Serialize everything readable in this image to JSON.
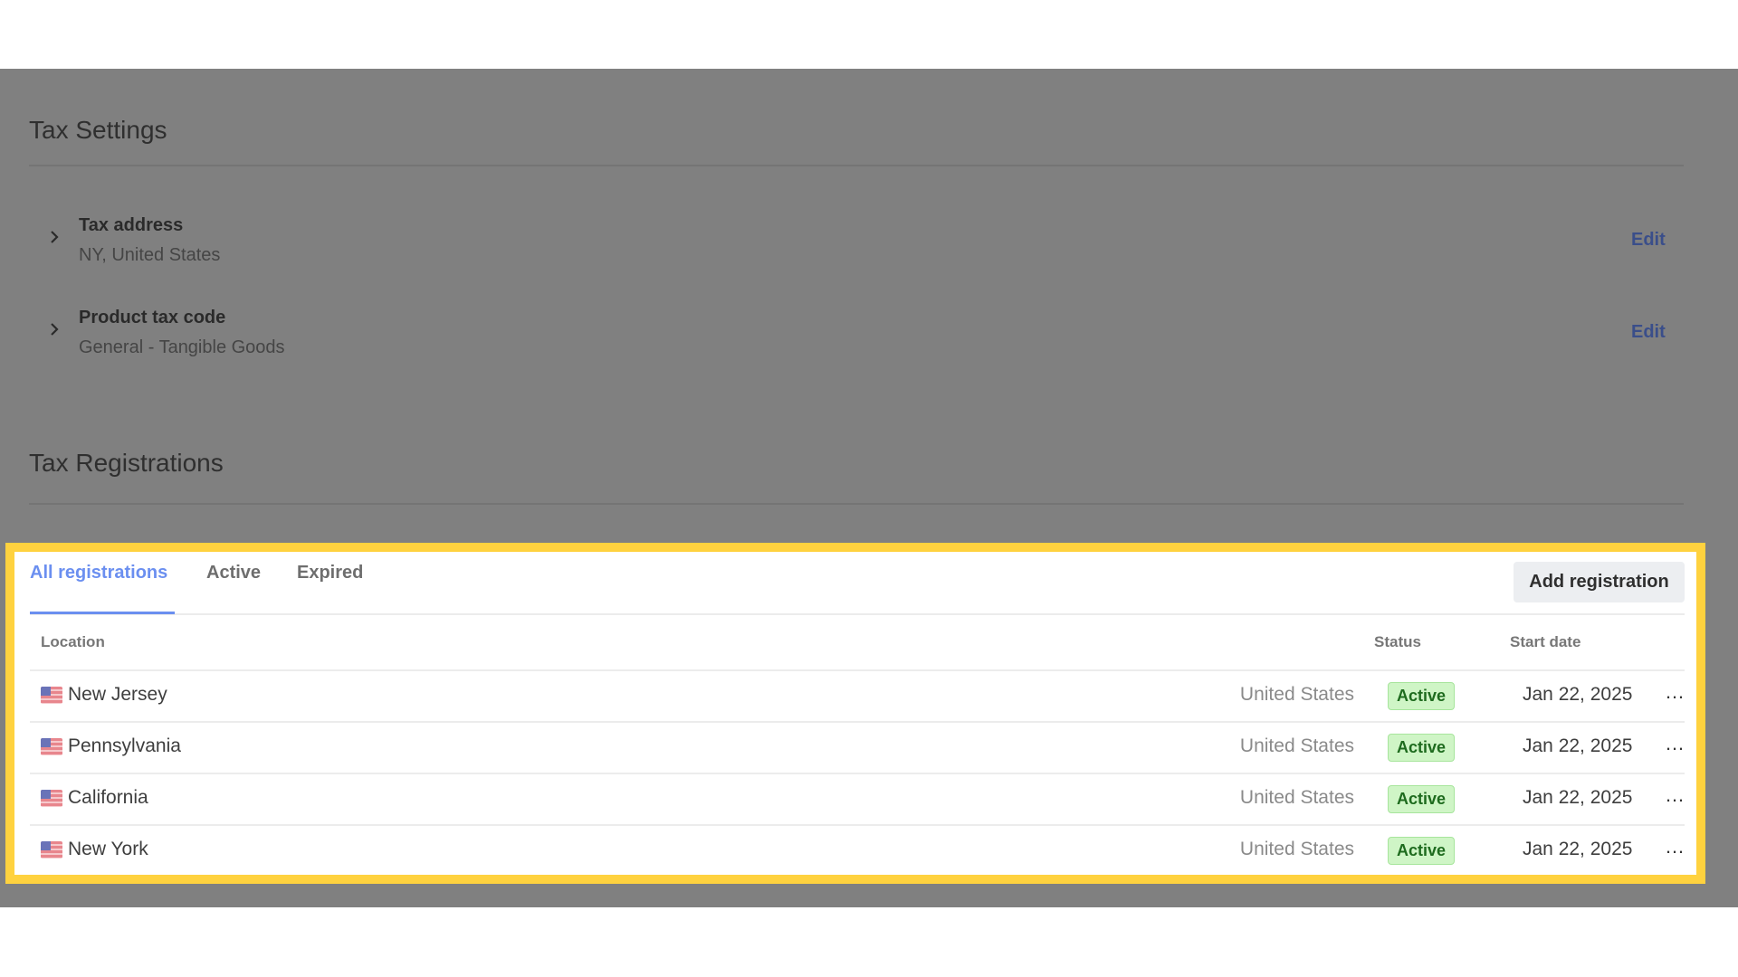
{
  "tax_settings": {
    "title": "Tax Settings",
    "items": [
      {
        "title": "Tax address",
        "value": "NY, United States",
        "action": "Edit"
      },
      {
        "title": "Product tax code",
        "value": "General - Tangible Goods",
        "action": "Edit"
      }
    ]
  },
  "tax_registrations": {
    "title": "Tax Registrations",
    "tabs": [
      {
        "label": "All registrations",
        "active": true
      },
      {
        "label": "Active",
        "active": false
      },
      {
        "label": "Expired",
        "active": false
      }
    ],
    "add_button": "Add registration",
    "columns": {
      "location": "Location",
      "status": "Status",
      "start_date": "Start date"
    },
    "rows": [
      {
        "flag": "us-flag-icon",
        "location": "New Jersey",
        "country": "United States",
        "status": "Active",
        "start_date": "Jan 22, 2025"
      },
      {
        "flag": "us-flag-icon",
        "location": "Pennsylvania",
        "country": "United States",
        "status": "Active",
        "start_date": "Jan 22, 2025"
      },
      {
        "flag": "us-flag-icon",
        "location": "California",
        "country": "United States",
        "status": "Active",
        "start_date": "Jan 22, 2025"
      },
      {
        "flag": "us-flag-icon",
        "location": "New York",
        "country": "United States",
        "status": "Active",
        "start_date": "Jan 22, 2025"
      }
    ],
    "more_icon": "…"
  },
  "colors": {
    "highlight": "#ffd23f",
    "tab_active": "#6b8ff0",
    "link": "#3a4e8a",
    "badge_bg": "#cff5c6",
    "badge_text": "#1e6b1e",
    "overlay": "#808080"
  }
}
